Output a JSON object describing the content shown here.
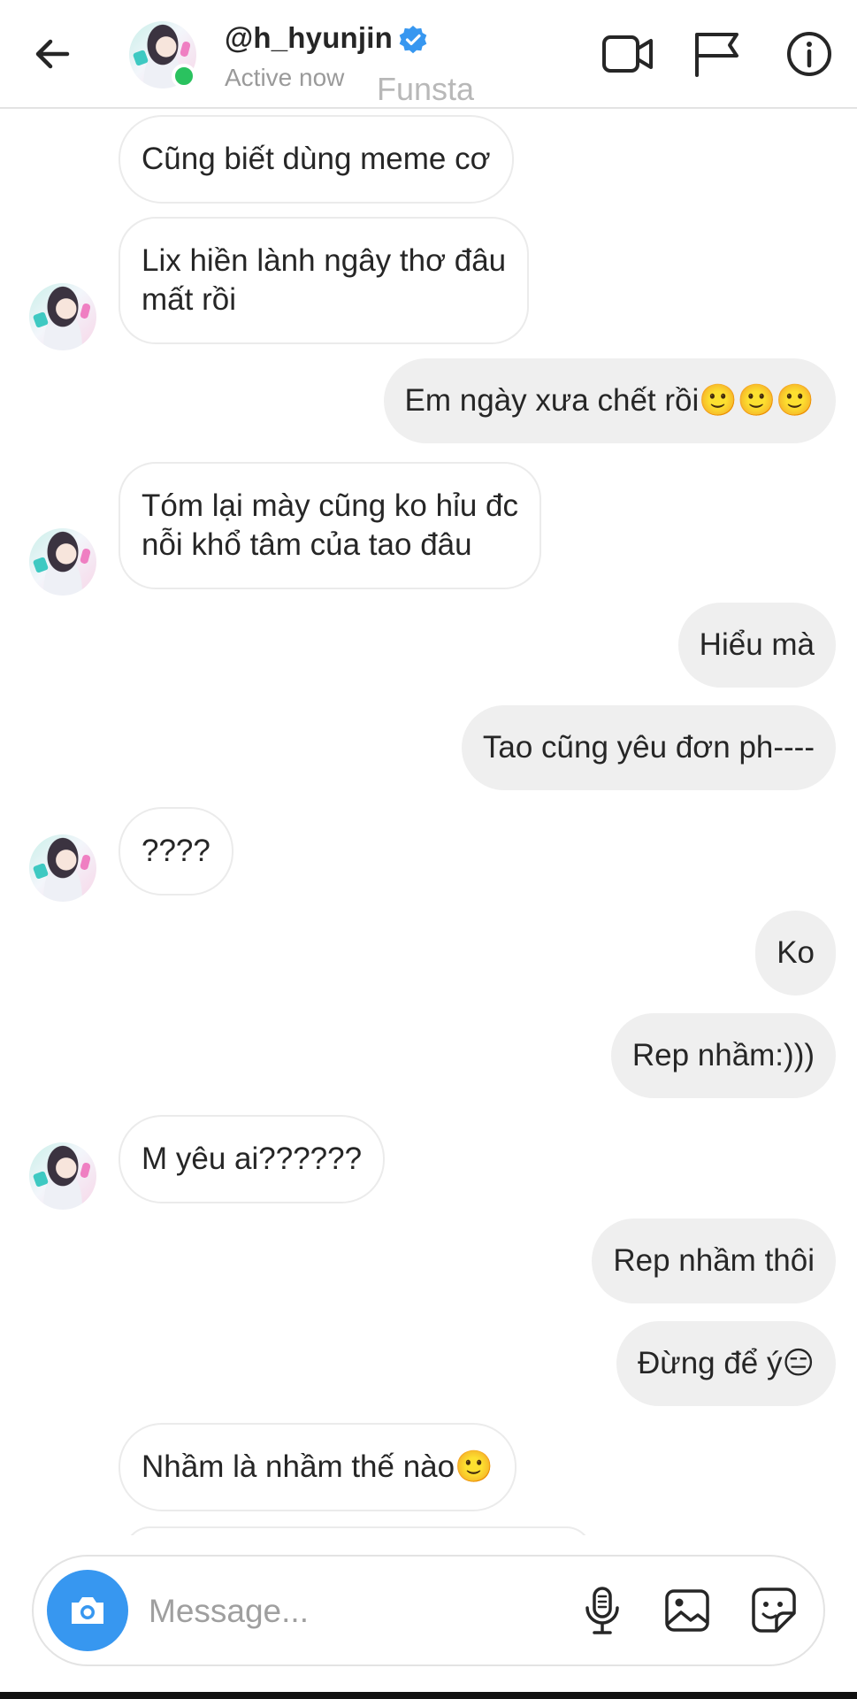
{
  "header": {
    "username": "@h_hyunjin",
    "status": "Active now",
    "watermark": "Funsta"
  },
  "messages": [
    {
      "side": "in",
      "text": "Cũng biết dùng meme cơ"
    },
    {
      "side": "in",
      "text": "Lix hiền lành ngây thơ đâu\nmất rồi"
    },
    {
      "side": "out",
      "text": "Em ngày xưa chết rồi🙂🙂🙂"
    },
    {
      "side": "in",
      "text": "Tóm lại mày cũng ko hỉu đc\nnỗi khổ tâm của tao đâu"
    },
    {
      "side": "out",
      "text": "Hiểu mà"
    },
    {
      "side": "out",
      "text": "Tao cũng yêu đơn ph----"
    },
    {
      "side": "in",
      "text": "????"
    },
    {
      "side": "out",
      "text": "Ko"
    },
    {
      "side": "out",
      "text": "Rep nhầm:)))"
    },
    {
      "side": "in",
      "text": "M yêu ai??????"
    },
    {
      "side": "out",
      "text": "Rep nhầm thôi"
    },
    {
      "side": "out",
      "text": "Đừng để ý😑"
    },
    {
      "side": "in",
      "text": "Nhầm là nhầm thế nào🙂"
    }
  ],
  "composer": {
    "placeholder": "Message..."
  },
  "colors": {
    "online": "#2ac25f",
    "verified": "#3797f0",
    "camera_button": "#3797f0",
    "outgoing_bubble": "#efefef"
  },
  "icons": [
    "back-arrow-icon",
    "verified-badge-icon",
    "video-call-icon",
    "flag-icon",
    "info-icon",
    "camera-icon",
    "microphone-icon",
    "gallery-icon",
    "sticker-icon"
  ]
}
